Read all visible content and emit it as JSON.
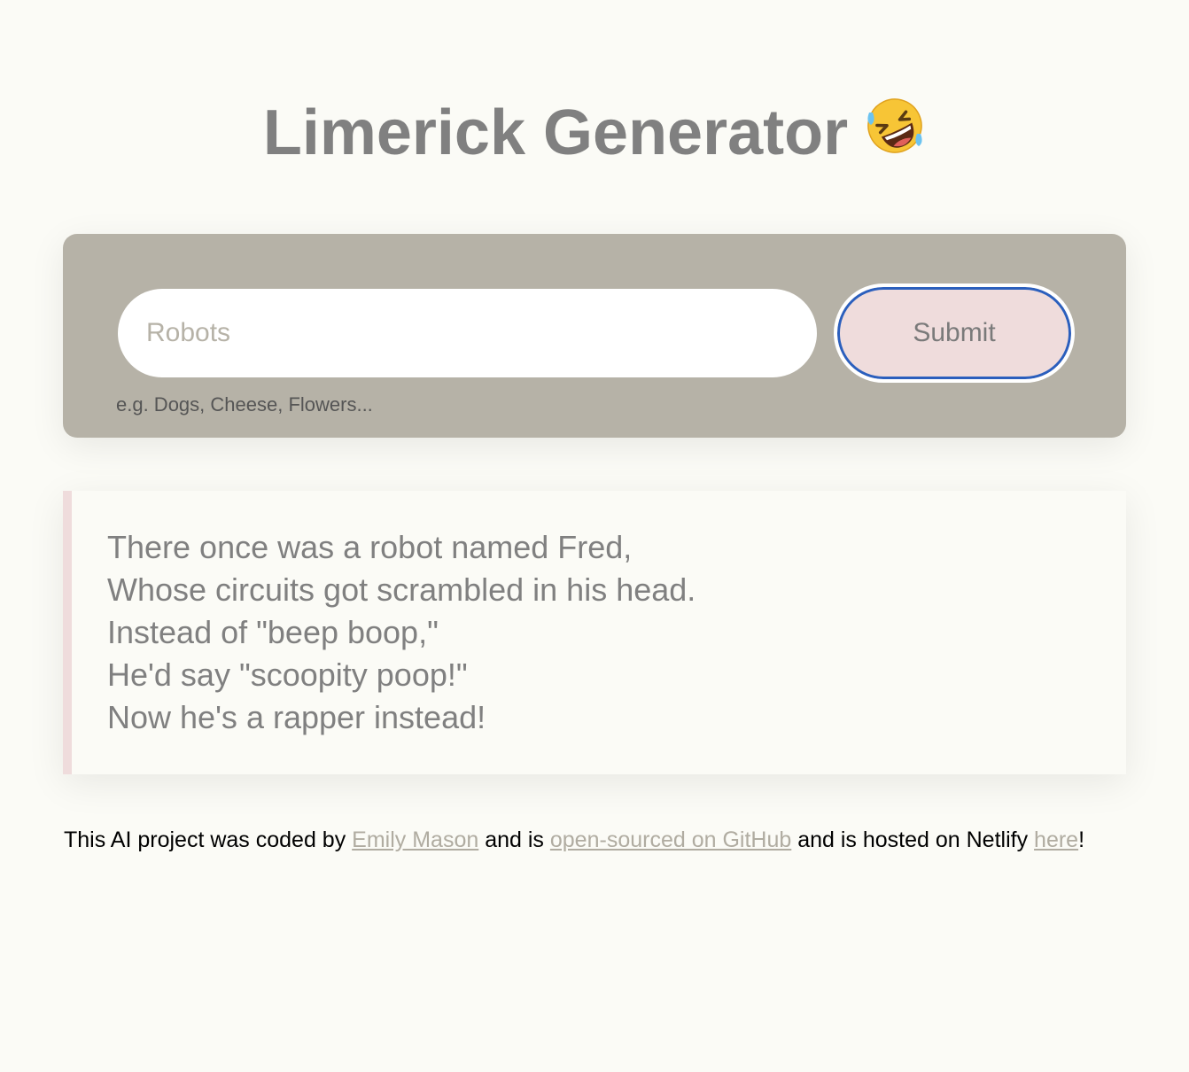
{
  "header": {
    "title": "Limerick Generator",
    "emoji": "rolling-on-the-floor-laughing"
  },
  "form": {
    "input_value": "",
    "input_placeholder": "Robots",
    "hint": "e.g. Dogs, Cheese, Flowers...",
    "submit_label": "Submit"
  },
  "result": {
    "lines": [
      "There once was a robot named Fred,",
      "Whose circuits got scrambled in his head.",
      "Instead of \"beep boop,\"",
      "He'd say \"scoopity poop!\"",
      "Now he's a rapper instead!"
    ]
  },
  "footer": {
    "text_1": "This AI project was coded by ",
    "author_link": "Emily Mason",
    "text_2": " and is ",
    "github_link": "open-sourced on GitHub",
    "text_3": " and is hosted on Netlify ",
    "here_link": "here",
    "text_4": "!"
  },
  "colors": {
    "background": "#fbfbf6",
    "card": "#b6b2a7",
    "button": "#efdcdc",
    "focus_ring": "#2b5fbd",
    "text": "#808080",
    "link": "#b0aca1"
  }
}
